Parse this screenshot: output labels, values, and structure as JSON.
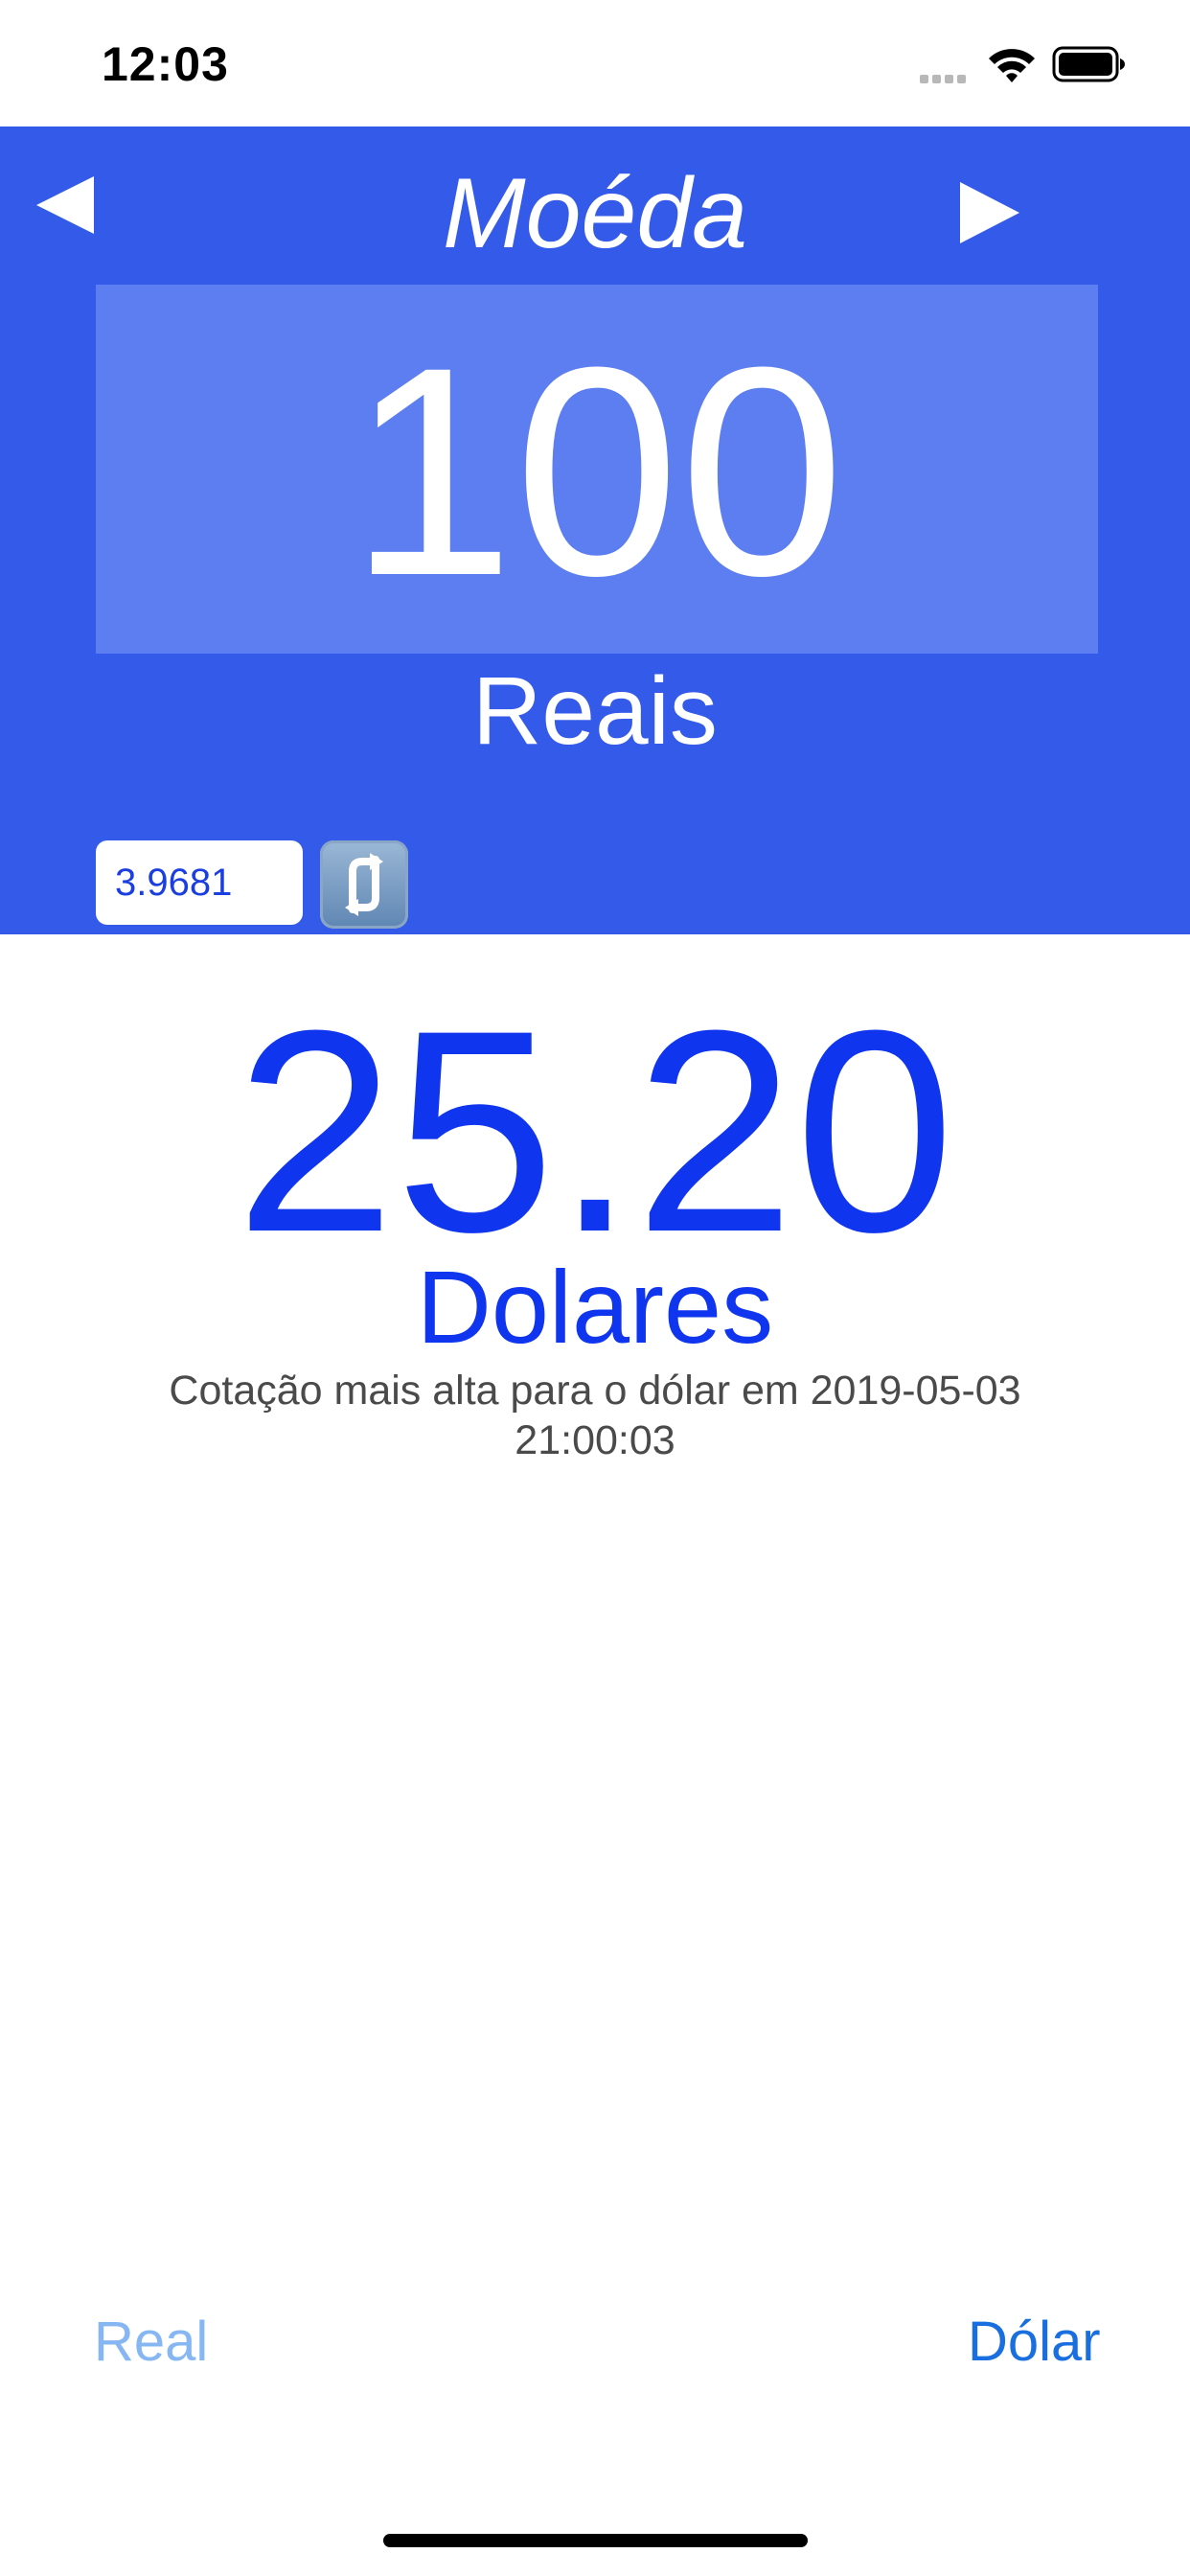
{
  "status_bar": {
    "time": "12:03",
    "icons": [
      "signal-icon",
      "wifi-icon",
      "battery-icon"
    ]
  },
  "header": {
    "title": "Moéda",
    "prev_icon": "triangle-left-icon",
    "next_icon": "triangle-right-icon",
    "amount": "100",
    "source_currency": "Reais",
    "rate_value": "3.9681",
    "refresh_icon": "refresh-arrows-icon"
  },
  "result": {
    "value": "25.20",
    "target_currency": "Dolares",
    "quote_info": "Cotação mais alta para o dólar em  2019-05-03\n21:00:03"
  },
  "bottom": {
    "real_label": "Real",
    "dolar_label": "Dólar"
  },
  "colors": {
    "header_bg": "#345ae9",
    "amount_box_bg": "#5d7ef0",
    "result_text": "#0f35ee",
    "real_button": "#86b7f3",
    "dolar_button": "#1a6fe0"
  }
}
